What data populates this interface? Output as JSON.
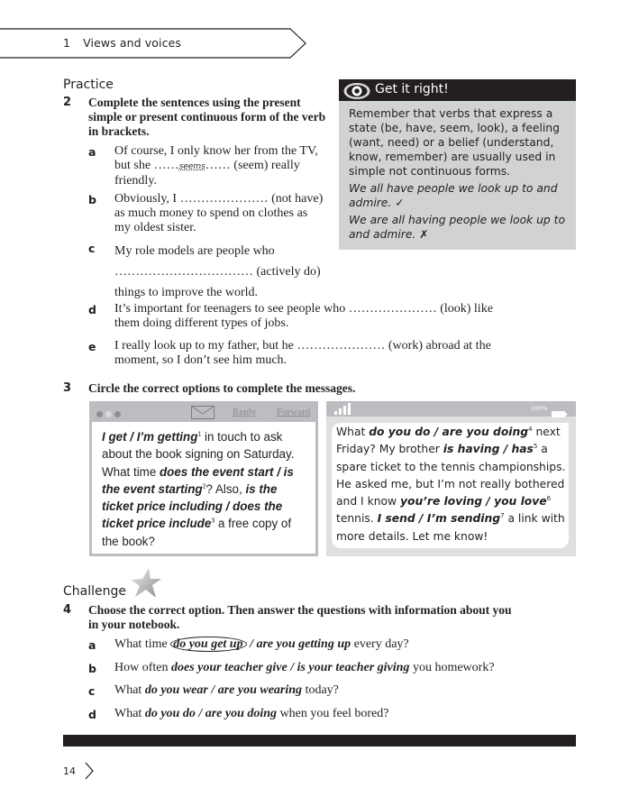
{
  "header": {
    "unit_number": "1",
    "unit_title": "Views and voices"
  },
  "practice": {
    "heading": "Practice",
    "exercise2": {
      "number": "2",
      "instruction_lines": [
        "Complete the sentences using the present",
        "simple or present continuous form of the verb",
        "in brackets."
      ],
      "items": [
        {
          "letter": "a",
          "lines": [
            "Of course, I only know her from the TV,",
            "but she ",
            " (seem) really",
            "friendly."
          ],
          "dots_before": "……",
          "answer": "seems",
          "dots_after": "……"
        },
        {
          "letter": "b",
          "lines": [
            "Obviously, I ………………… (not have)",
            "as much money to spend on clothes as",
            "my oldest sister."
          ]
        },
        {
          "letter": "c",
          "lines": [
            "My role models are people who",
            "…………………………… (actively do)",
            "things to improve the world."
          ]
        },
        {
          "letter": "d",
          "lines": [
            "It’s important for teenagers to see people who ………………… (look) like",
            "them doing different types of jobs."
          ]
        },
        {
          "letter": "e",
          "lines": [
            "I really look up to my father, but he ………………… (work) abroad at the",
            "moment, so I don’t see him much."
          ]
        }
      ]
    }
  },
  "get_it_right": {
    "title": "Get it right!",
    "icon": "eye-icon",
    "rule": "Remember that verbs that express a state (be, have, seem, look), a feeling (want, need) or a belief (understand, know, remember) are usually used in simple not continuous forms.",
    "correct_example": "We all have people we look up to and admire.",
    "correct_mark": "✓",
    "incorrect_example": "We are all having people we look up to and admire.",
    "incorrect_mark": "✗"
  },
  "exercise3": {
    "number": "3",
    "instruction": "Circle the correct options to complete the messages.",
    "email": {
      "reply_label": "Reply",
      "forward_label": "Forward",
      "icon": "envelope-icon",
      "segments": {
        "s1_opt": "I get / I’m getting",
        "s1_num": "1",
        "s1_rest": " in touch to ask about the book signing on Saturday. What time ",
        "s2_opt": "does the event start / is the event starting",
        "s2_num": "2",
        "s2_rest": "? Also, ",
        "s3_opt": "is the ticket price including / does the ticket price include",
        "s3_num": "3",
        "s3_rest": " a free copy of the book?"
      }
    },
    "sms": {
      "battery_label": "100%",
      "icon": "signal-icon",
      "segments": {
        "p1": "What ",
        "o4": "do you do / are you doing",
        "n4": "4",
        "p2": " next Friday? My brother ",
        "o5": "is having / has",
        "n5": "5",
        "p3": " a spare ticket to the tennis championships. He asked me, but I’m not really bothered and I know ",
        "o6": "you’re loving / you love",
        "n6": "6",
        "p4": " tennis. ",
        "o7": "I send / I’m sending",
        "n7": "7",
        "p5": " a link with more details. Let me know!"
      }
    }
  },
  "challenge": {
    "heading": "Challenge",
    "icon": "star-icon",
    "exercise4": {
      "number": "4",
      "instruction_lines": [
        "Choose the correct option. Then answer the questions with information about you",
        "in your notebook."
      ],
      "items": [
        {
          "letter": "a",
          "before": "What time ",
          "opt1": "do you get up",
          "sep": " / ",
          "opt2": "are you getting up",
          "after": " every day?",
          "circled": "do you get up"
        },
        {
          "letter": "b",
          "before": "How often ",
          "opt1": "does your teacher give",
          "sep": " / ",
          "opt2": "is your teacher giving",
          "after": " you homework?"
        },
        {
          "letter": "c",
          "before": "What ",
          "opt1": "do you wear",
          "sep": " / ",
          "opt2": "are you wearing",
          "after": " today?"
        },
        {
          "letter": "d",
          "before": "What ",
          "opt1": "do you do",
          "sep": " / ",
          "opt2": "are you doing",
          "after": " when you feel bored?"
        }
      ]
    }
  },
  "footer": {
    "page_number": "14",
    "next_icon": "chevron-right-icon"
  },
  "colors": {
    "text": "#231f20",
    "box_grey": "#d1d2d4",
    "header_black": "#231f20",
    "email_frame": "#bcbdc0",
    "phone_bg": "#dedfe0"
  }
}
